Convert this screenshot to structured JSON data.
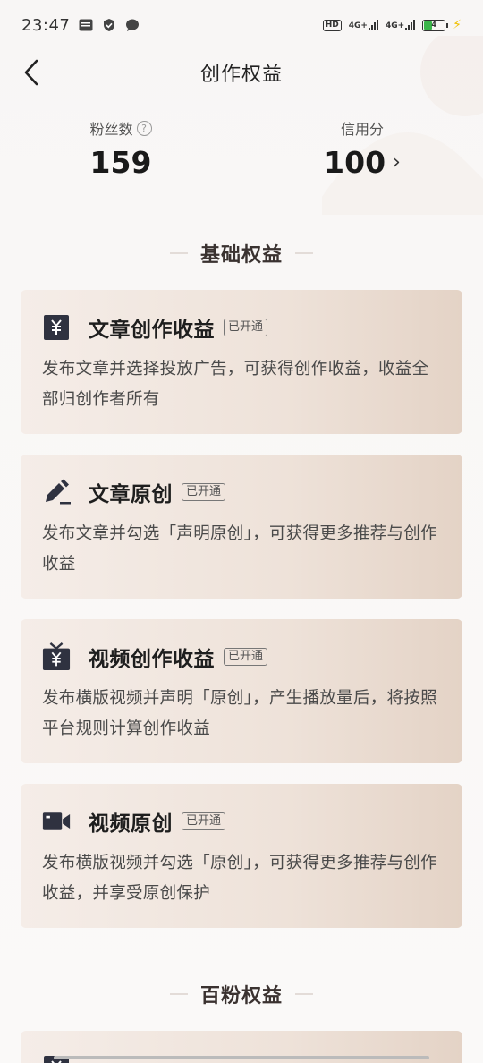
{
  "status_bar": {
    "time": "23:47",
    "left_icons": [
      "news-icon",
      "shield-icon",
      "chat-icon"
    ],
    "hd_label": "HD",
    "net1": "4G+",
    "net2": "4G+",
    "battery_level": "4"
  },
  "nav": {
    "title": "创作权益"
  },
  "stats": {
    "fans_label": "粉丝数",
    "fans_value": "159",
    "credit_label": "信用分",
    "credit_value": "100"
  },
  "sections": [
    {
      "title": "基础权益",
      "cards": [
        {
          "icon": "yuan-icon",
          "title": "文章创作收益",
          "badge": "已开通",
          "desc": "发布文章并选择投放广告，可获得创作收益，收益全部归创作者所有"
        },
        {
          "icon": "pen-icon",
          "title": "文章原创",
          "badge": "已开通",
          "desc": "发布文章并勾选「声明原创」，可获得更多推荐与创作收益"
        },
        {
          "icon": "tv-yuan-icon",
          "title": "视频创作收益",
          "badge": "已开通",
          "desc": "发布横版视频并声明「原创」，产生播放量后，将按照平台规则计算创作收益"
        },
        {
          "icon": "video-camera-icon",
          "title": "视频原创",
          "badge": "已开通",
          "desc": "发布横版视频并勾选「原创」，可获得更多推荐与创作收益，并享受原创保护"
        }
      ]
    },
    {
      "title": "百粉权益",
      "cards": [
        {
          "icon": "yuan-icon"
        }
      ]
    }
  ],
  "colors": {
    "card_start": "#f5ede8",
    "card_end": "#e4d3c6",
    "title": "#1e1e1e",
    "desc": "#4a4a4a"
  }
}
